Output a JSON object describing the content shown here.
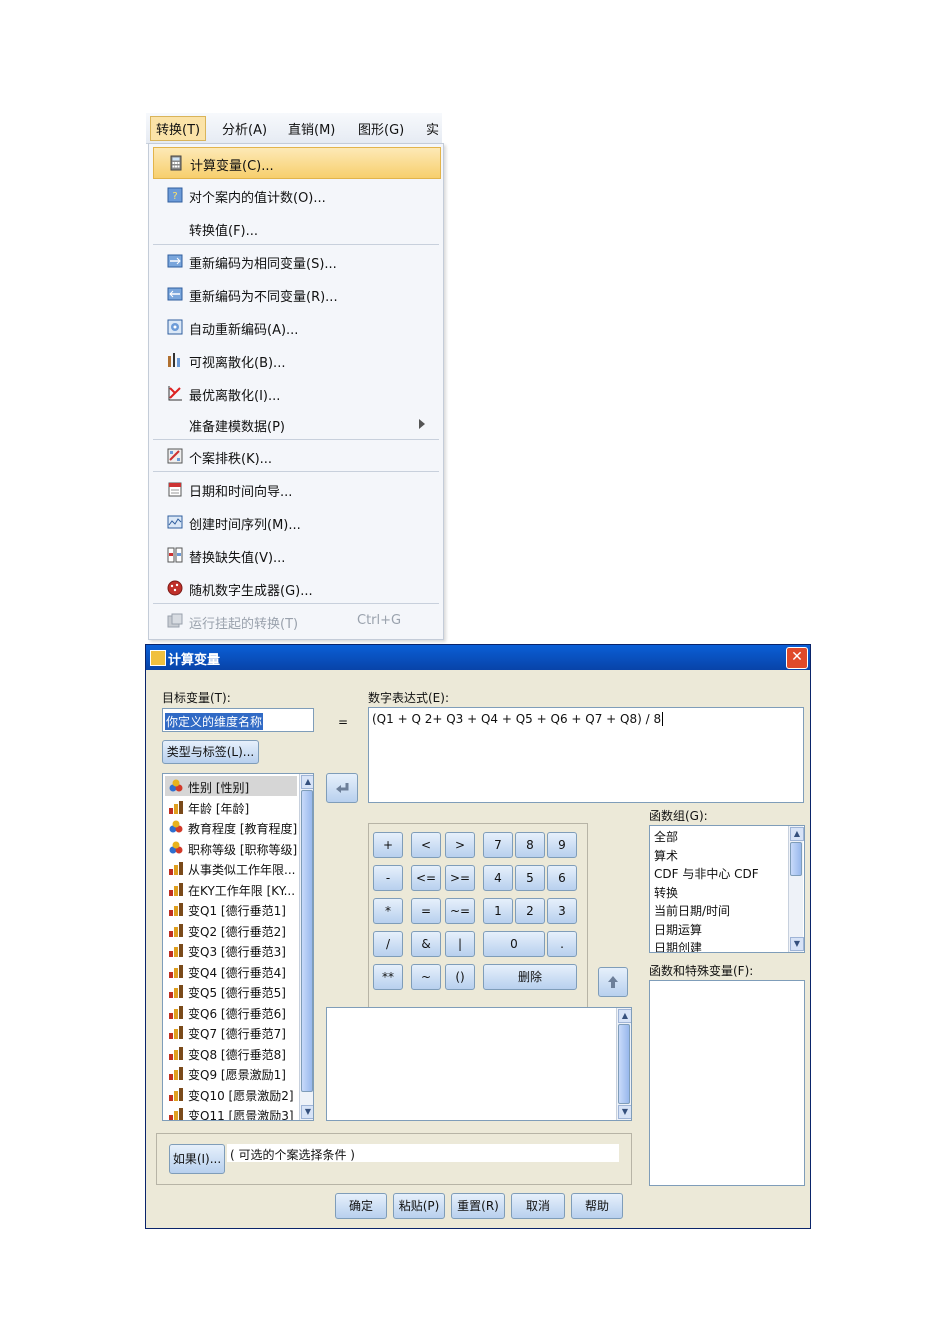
{
  "menubar": {
    "items": [
      "转换(T)",
      "分析(A)",
      "直销(M)",
      "图形(G)",
      "实"
    ]
  },
  "transform_menu": {
    "items": [
      {
        "label": "计算变量(C)...",
        "icon": "calculator-icon"
      },
      {
        "label": "对个案内的值计数(O)...",
        "icon": "count-icon"
      },
      {
        "label": "转换值(F)...",
        "icon": ""
      },
      {
        "label": "重新编码为相同变量(S)...",
        "icon": "recode-same-icon"
      },
      {
        "label": "重新编码为不同变量(R)...",
        "icon": "recode-different-icon"
      },
      {
        "label": "自动重新编码(A)...",
        "icon": "auto-recode-icon"
      },
      {
        "label": "可视离散化(B)...",
        "icon": "visual-binning-icon"
      },
      {
        "label": "最优离散化(I)...",
        "icon": "optimal-binning-icon"
      },
      {
        "label": "准备建模数据(P)",
        "icon": ""
      },
      {
        "label": "个案排秩(K)...",
        "icon": "rank-cases-icon"
      },
      {
        "label": "日期和时间向导...",
        "icon": "date-wizard-icon"
      },
      {
        "label": "创建时间序列(M)...",
        "icon": "time-series-icon"
      },
      {
        "label": "替换缺失值(V)...",
        "icon": "replace-missing-icon"
      },
      {
        "label": "随机数字生成器(G)...",
        "icon": "random-dice-icon"
      },
      {
        "label": "运行挂起的转换(T)",
        "icon": "run-pending-icon",
        "shortcut": "Ctrl+G"
      }
    ]
  },
  "dialog": {
    "title": "计算变量",
    "close": "✕",
    "target_label": "目标变量(T):",
    "target_value": "你定义的维度名称",
    "type_label_button": "类型与标签(L)...",
    "expr_label": "数字表达式(E):",
    "expr_value": "(Q1 + Q 2+ Q3 + Q4 + Q5 + Q6  + Q7 + Q8) / 8",
    "equals": "=",
    "variables": [
      {
        "label": "性别 [性别]",
        "icon": "nominal-icon"
      },
      {
        "label": "年龄 [年龄]",
        "icon": "scale-icon"
      },
      {
        "label": "教育程度 [教育程度]",
        "icon": "nominal-icon"
      },
      {
        "label": "职称等级 [职称等级]",
        "icon": "nominal-icon"
      },
      {
        "label": "从事类似工作年限...",
        "icon": "scale-icon"
      },
      {
        "label": "在KY工作年限 [KY...",
        "icon": "scale-icon"
      },
      {
        "label": "变Q1 [德行垂范1]",
        "icon": "scale-icon"
      },
      {
        "label": "变Q2 [德行垂范2]",
        "icon": "scale-icon"
      },
      {
        "label": "变Q3 [德行垂范3]",
        "icon": "scale-icon"
      },
      {
        "label": "变Q4 [德行垂范4]",
        "icon": "scale-icon"
      },
      {
        "label": "变Q5 [德行垂范5]",
        "icon": "scale-icon"
      },
      {
        "label": "变Q6 [德行垂范6]",
        "icon": "scale-icon"
      },
      {
        "label": "变Q7 [德行垂范7]",
        "icon": "scale-icon"
      },
      {
        "label": "变Q8 [德行垂范8]",
        "icon": "scale-icon"
      },
      {
        "label": "变Q9 [愿景激励1]",
        "icon": "scale-icon"
      },
      {
        "label": "变Q10 [愿景激励2]",
        "icon": "scale-icon"
      },
      {
        "label": "变Q11 [愿景激励3]",
        "icon": "scale-icon"
      }
    ],
    "keypad": {
      "row1": [
        "+",
        "<",
        ">",
        "7",
        "8",
        "9"
      ],
      "row2": [
        "-",
        "<=",
        ">=",
        "4",
        "5",
        "6"
      ],
      "row3": [
        "*",
        "=",
        "~=",
        "1",
        "2",
        "3"
      ],
      "row4": [
        "/",
        "&",
        "|",
        "0",
        "."
      ],
      "row5": [
        "**",
        "~",
        "()",
        "删除"
      ]
    },
    "function_group_label": "函数组(G):",
    "function_groups": [
      "全部",
      "算术",
      "CDF 与非中心 CDF",
      "转换",
      "当前日期/时间",
      "日期运算",
      "日期创建"
    ],
    "functions_label": "函数和特殊变量(F):",
    "if_button": "如果(I)...",
    "if_placeholder": "( 可选的个案选择条件 )",
    "buttons": [
      "确定",
      "粘贴(P)",
      "重置(R)",
      "取消",
      "帮助"
    ]
  },
  "colors": {
    "titlebar": "#0a5fd6",
    "highlight": "#f7cf6d",
    "dialog_bg": "#ece9d8"
  }
}
